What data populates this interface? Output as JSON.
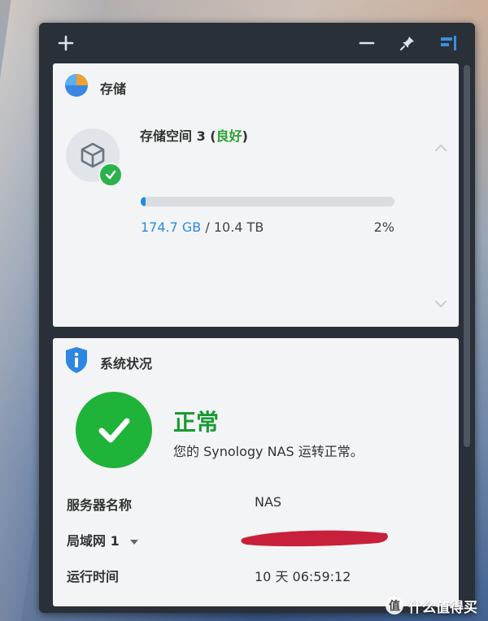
{
  "toolbar": {
    "add_icon": "plus-icon",
    "minimize_icon": "minus-icon",
    "pin_icon": "pin-icon",
    "layout_icon": "layout-icon",
    "accent": "#3a8fe0"
  },
  "storage": {
    "title": "存储",
    "volume_name": "存储空间 3 (",
    "volume_status": "良好",
    "volume_name_close": ")",
    "used": "174.7 GB",
    "separator": " / ",
    "total": "10.4 TB",
    "percent_text": "2%",
    "fill_fraction": 0.02
  },
  "status": {
    "title": "系统状况",
    "state": "正常",
    "description": "您的 Synology NAS 运转正常。",
    "rows": [
      {
        "label": "服务器名称",
        "value": "NAS"
      },
      {
        "label": "局域网 1",
        "value": ""
      },
      {
        "label": "运行时间",
        "value": "10 天 06:59:12"
      }
    ]
  },
  "colors": {
    "ok_green": "#1fb33a",
    "link_blue": "#2b8be0",
    "progress_blue": "#1e88e5",
    "redaction_red": "#c8203a"
  },
  "watermark": {
    "badge": "值",
    "text": "什么值得买"
  }
}
